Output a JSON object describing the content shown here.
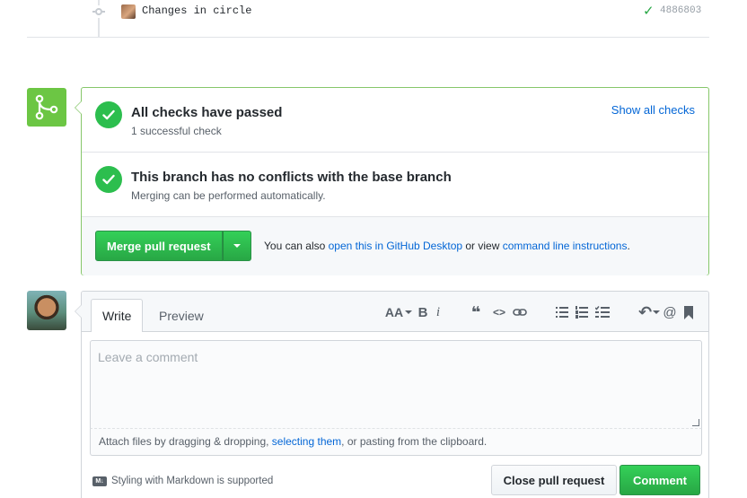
{
  "commit": {
    "message": "Changes in circle",
    "sha": "4886803",
    "status_icon": "check-icon"
  },
  "merge": {
    "badge_icon": "git-merge-icon",
    "checks_title": "All checks have passed",
    "checks_sub": "1 successful check",
    "show_checks": "Show all checks",
    "conflict_title": "This branch has no conflicts with the base branch",
    "conflict_sub": "Merging can be performed automatically.",
    "merge_button": "Merge pull request",
    "alt_prefix": "You can also ",
    "alt_link1": "open this in GitHub Desktop",
    "alt_mid": " or view ",
    "alt_link2": "command line instructions",
    "alt_suffix": ".",
    "accent_color": "#2cbe4e"
  },
  "comment": {
    "tab_write": "Write",
    "tab_preview": "Preview",
    "toolbar": {
      "header": "AA",
      "bold": "B",
      "italic": "i",
      "quote": "❝",
      "code": "<>",
      "link": "⊂⊃",
      "reply": "↶",
      "mention": "@"
    },
    "placeholder": "Leave a comment",
    "attach_prefix": "Attach files by dragging & dropping, ",
    "attach_link": "selecting them",
    "attach_suffix": ", or pasting from the clipboard.",
    "markdown_hint": "Styling with Markdown is supported",
    "close_button": "Close pull request",
    "comment_button": "Comment"
  }
}
